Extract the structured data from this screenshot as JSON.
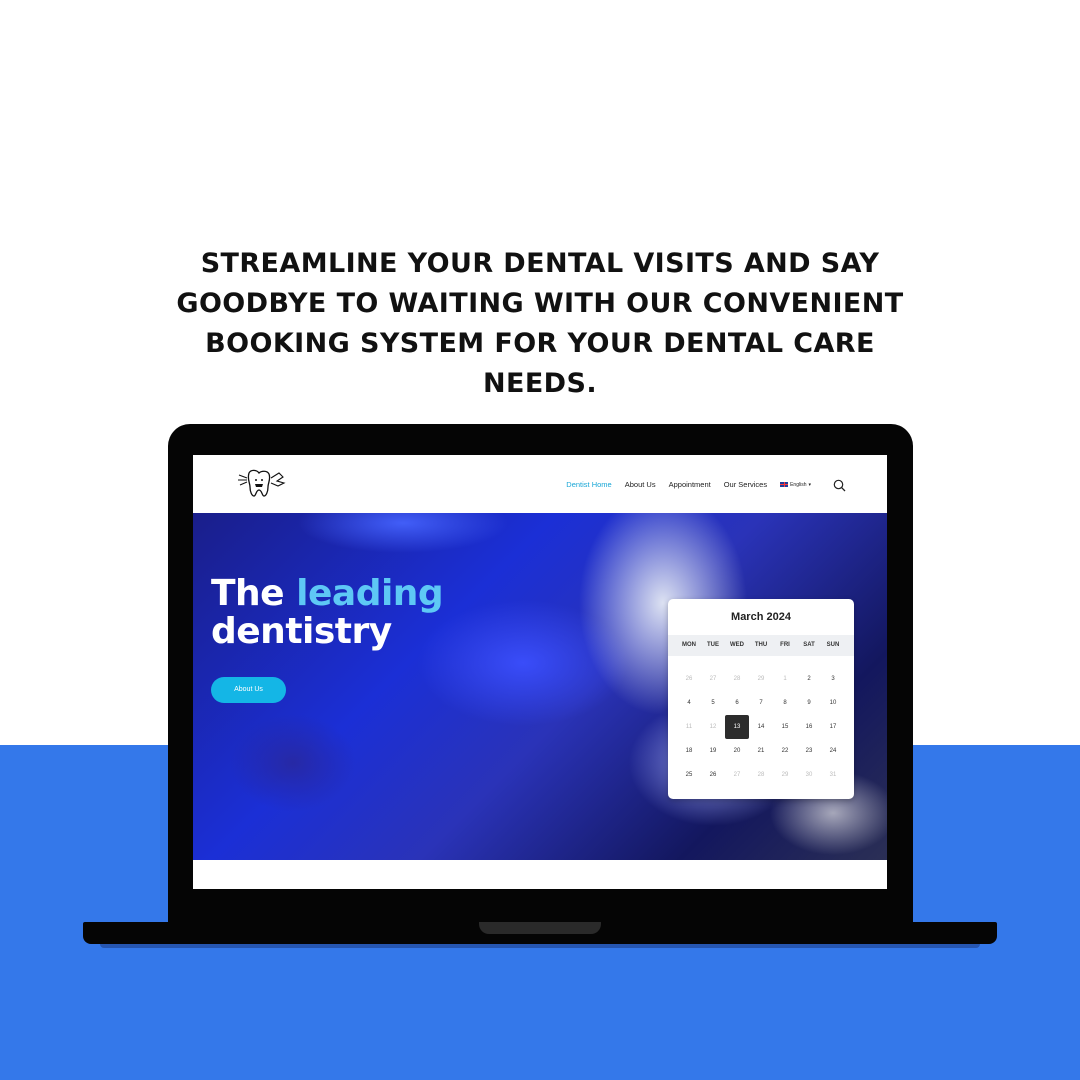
{
  "headline": {
    "lines": [
      "STREAMLINE YOUR DENTAL VISITS AND SAY",
      "GOODBYE TO WAITING WITH OUR CONVENIENT",
      "BOOKING SYSTEM FOR YOUR DENTAL CARE",
      "NEEDS."
    ]
  },
  "colors": {
    "accent_blue": "#3478ea",
    "nav_active": "#17a6d6",
    "button": "#14b6e6",
    "hero_accent": "#5ec8f5"
  },
  "nav": {
    "logo_icon": "tooth-logo-icon",
    "links": [
      "Dentist Home",
      "About Us",
      "Appointment",
      "Our Services"
    ],
    "active_index": 0,
    "language": "English",
    "language_flag": "uk-flag-icon",
    "search_icon": "search-icon"
  },
  "hero": {
    "title_part1": "The ",
    "title_accent": "leading",
    "title_part2": "dentistry",
    "button_label": "About Us"
  },
  "calendar": {
    "month_label": "March 2024",
    "weekdays": [
      "MON",
      "TUE",
      "WED",
      "THU",
      "FRI",
      "SAT",
      "SUN"
    ],
    "days": [
      {
        "d": "26",
        "muted": true
      },
      {
        "d": "27",
        "muted": true
      },
      {
        "d": "28",
        "muted": true
      },
      {
        "d": "29",
        "muted": true
      },
      {
        "d": "1",
        "muted": true
      },
      {
        "d": "2",
        "muted": false
      },
      {
        "d": "3",
        "muted": false
      },
      {
        "d": "4",
        "muted": false
      },
      {
        "d": "5",
        "muted": false
      },
      {
        "d": "6",
        "muted": false
      },
      {
        "d": "7",
        "muted": false
      },
      {
        "d": "8",
        "muted": false
      },
      {
        "d": "9",
        "muted": false
      },
      {
        "d": "10",
        "muted": false
      },
      {
        "d": "11",
        "muted": true
      },
      {
        "d": "12",
        "muted": true
      },
      {
        "d": "13",
        "muted": false,
        "selected": true
      },
      {
        "d": "14",
        "muted": false
      },
      {
        "d": "15",
        "muted": false
      },
      {
        "d": "16",
        "muted": false
      },
      {
        "d": "17",
        "muted": false
      },
      {
        "d": "18",
        "muted": false
      },
      {
        "d": "19",
        "muted": false
      },
      {
        "d": "20",
        "muted": false
      },
      {
        "d": "21",
        "muted": false
      },
      {
        "d": "22",
        "muted": false
      },
      {
        "d": "23",
        "muted": false
      },
      {
        "d": "24",
        "muted": false
      },
      {
        "d": "25",
        "muted": false
      },
      {
        "d": "26",
        "muted": false
      },
      {
        "d": "27",
        "muted": true
      },
      {
        "d": "28",
        "muted": true
      },
      {
        "d": "29",
        "muted": true
      },
      {
        "d": "30",
        "muted": true
      },
      {
        "d": "31",
        "muted": true
      }
    ]
  }
}
